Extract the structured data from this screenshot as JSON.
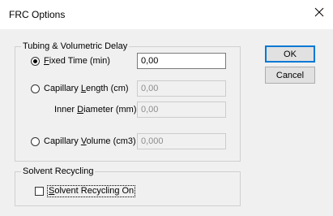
{
  "window": {
    "title": "FRC Options",
    "close_icon": "close-icon"
  },
  "tubing_group": {
    "legend": "Tubing & Volumetric Delay",
    "fixed_time": {
      "label_pre": "",
      "label_u": "F",
      "label_post": "ixed Time (min)",
      "value": "0,00",
      "selected": true
    },
    "capillary_length": {
      "label_pre": "Capillary ",
      "label_u": "L",
      "label_post": "ength (cm)",
      "value": "0,00",
      "selected": false
    },
    "inner_diameter": {
      "label_pre": "Inner ",
      "label_u": "D",
      "label_post": "iameter (mm)",
      "value": "0,00"
    },
    "capillary_volume": {
      "label_pre": "Capillary ",
      "label_u": "V",
      "label_post": "olume (cm3)",
      "value": "0,000",
      "selected": false
    }
  },
  "buttons": {
    "ok_label": "OK",
    "cancel_label": "Cancel"
  },
  "solvent_group": {
    "legend": "Solvent Recycling",
    "checkbox": {
      "label_pre": "",
      "label_u": "S",
      "label_post": "olvent Recycling On",
      "checked": false
    }
  },
  "colors": {
    "dialog_bg": "#f0f0f0",
    "title_bg": "#ffffff",
    "accent": "#0078d7"
  }
}
